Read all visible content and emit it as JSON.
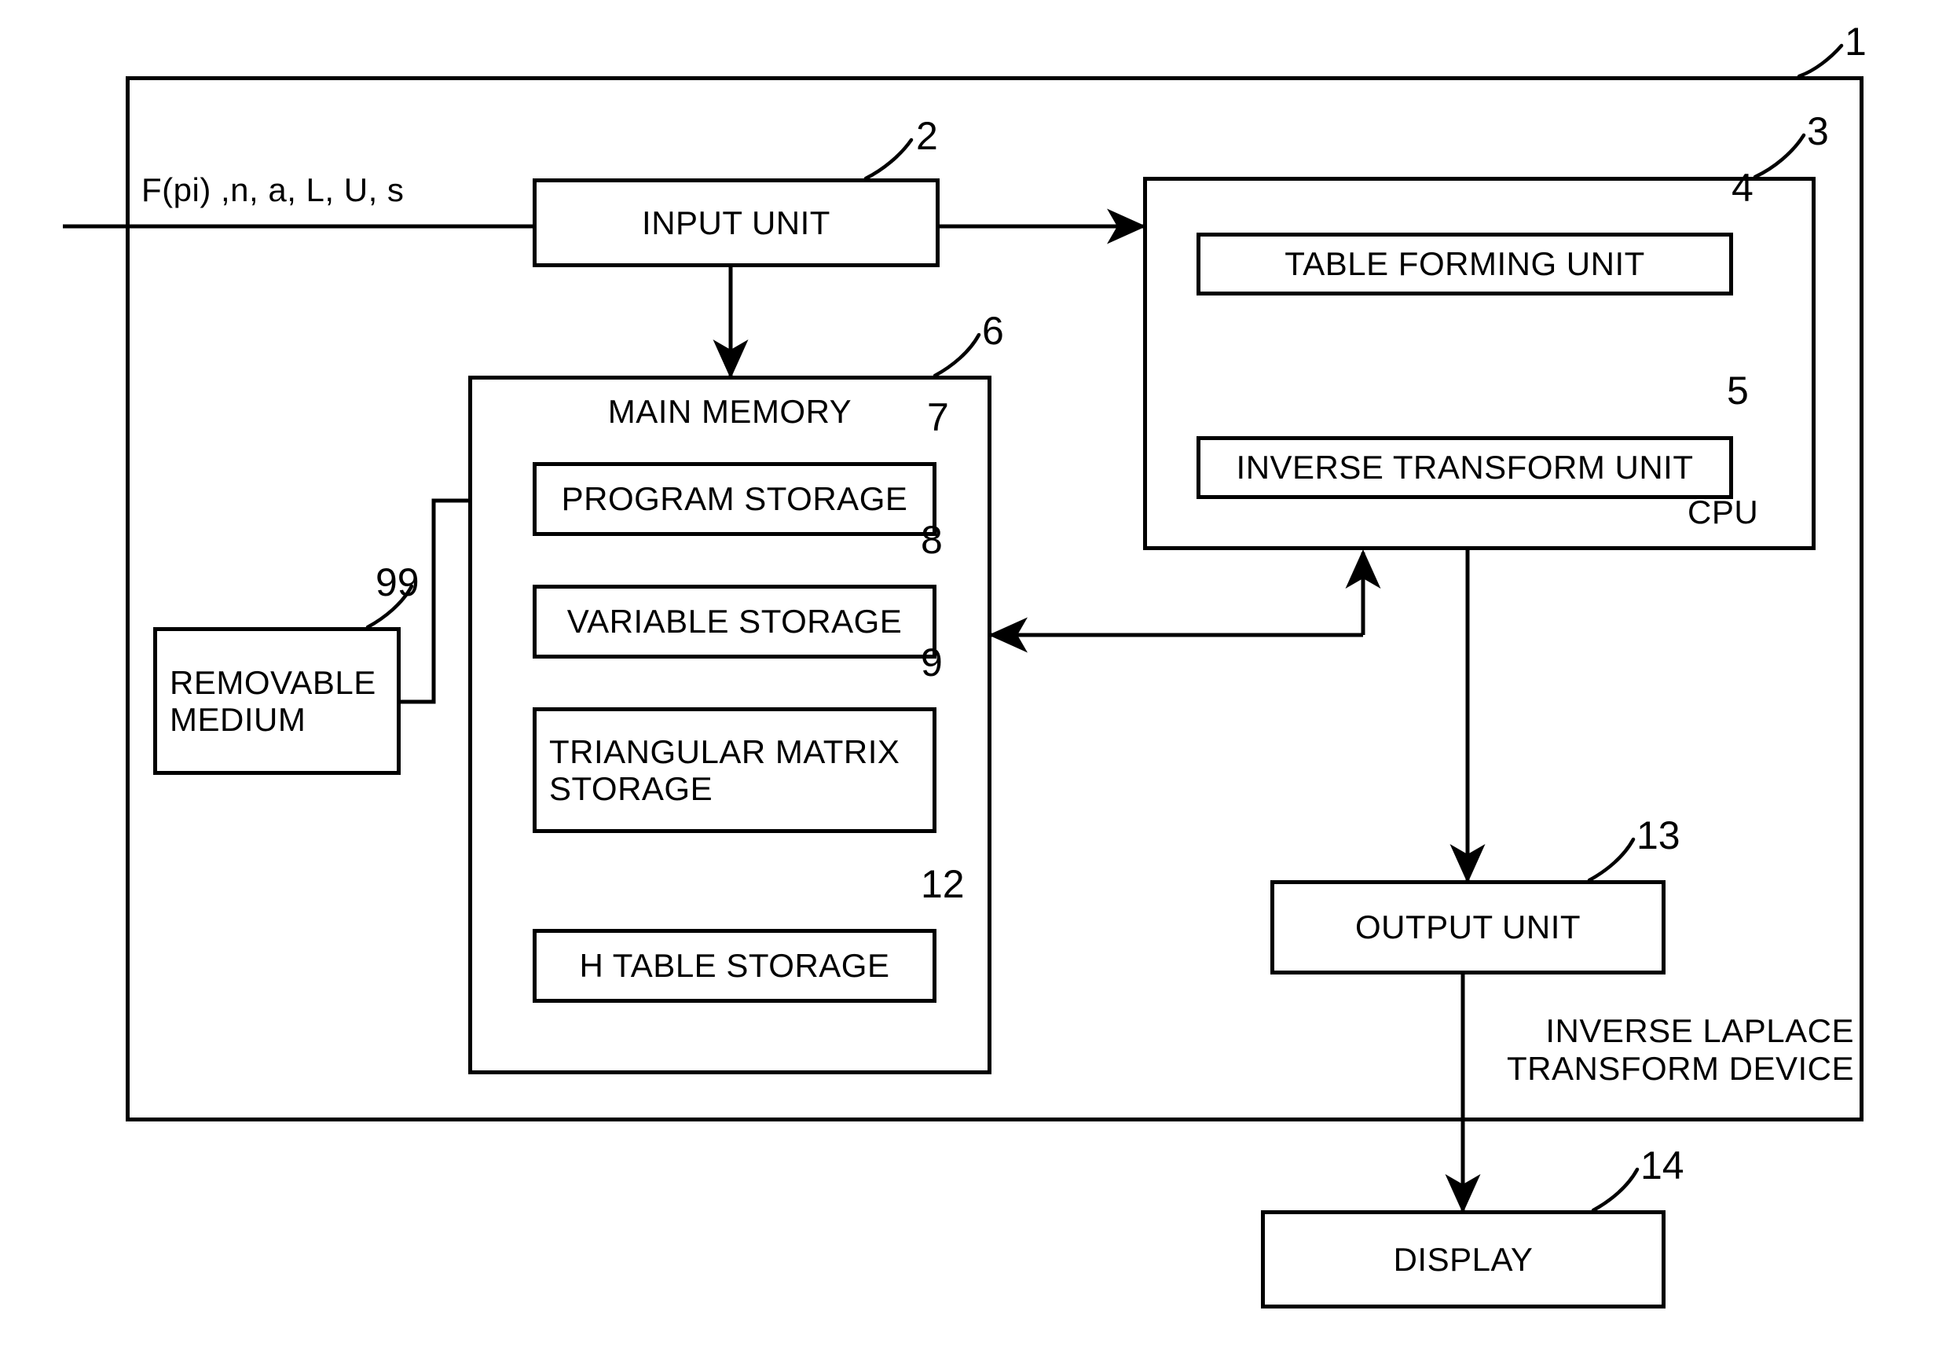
{
  "figure": {
    "type": "patent-block-diagram",
    "device_name": "INVERSE LAPLACE TRANSFORM DEVICE",
    "input_signal_label": "F(pi) ,n, a, L, U, s",
    "cpu_label": "CPU",
    "line_color": "#000000",
    "background_color": "#ffffff"
  },
  "blocks": {
    "device_outer": {
      "ref": "1",
      "label": ""
    },
    "input_unit": {
      "ref": "2",
      "label": "INPUT UNIT"
    },
    "cpu": {
      "ref": "3",
      "label": "CPU"
    },
    "table_forming_unit": {
      "ref": "4",
      "label": "TABLE FORMING UNIT"
    },
    "inverse_transform_unit": {
      "ref": "5",
      "label": "INVERSE TRANSFORM UNIT"
    },
    "main_memory": {
      "ref": "6",
      "label": "MAIN MEMORY"
    },
    "program_storage": {
      "ref": "7",
      "label": "PROGRAM STORAGE"
    },
    "variable_storage": {
      "ref": "8",
      "label": "VARIABLE STORAGE"
    },
    "triangular_matrix_storage": {
      "ref": "9",
      "label": "TRIANGULAR MATRIX\nSTORAGE"
    },
    "h_table_storage": {
      "ref": "12",
      "label": "H TABLE STORAGE"
    },
    "output_unit": {
      "ref": "13",
      "label": "OUTPUT UNIT"
    },
    "display": {
      "ref": "14",
      "label": "DISPLAY"
    },
    "removable_medium": {
      "ref": "99",
      "label": "REMOVABLE\nMEDIUM"
    }
  },
  "annotations": {
    "device_caption": "INVERSE LAPLACE\nTRANSFORM DEVICE"
  },
  "reference_numerals": [
    "1",
    "2",
    "3",
    "4",
    "5",
    "6",
    "7",
    "8",
    "9",
    "12",
    "13",
    "14",
    "99"
  ]
}
